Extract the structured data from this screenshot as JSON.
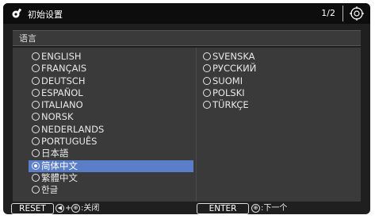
{
  "titlebar": {
    "title": "初始设置",
    "page_indicator": "1/2"
  },
  "section": {
    "label": "语言"
  },
  "languages_left": [
    {
      "label": "ENGLISH",
      "selected": false
    },
    {
      "label": "FRANÇAIS",
      "selected": false
    },
    {
      "label": "DEUTSCH",
      "selected": false
    },
    {
      "label": "ESPAÑOL",
      "selected": false
    },
    {
      "label": "ITALIANO",
      "selected": false
    },
    {
      "label": "NORSK",
      "selected": false
    },
    {
      "label": "NEDERLANDS",
      "selected": false
    },
    {
      "label": "PORTUGUÊS",
      "selected": false
    },
    {
      "label": "日本語",
      "selected": false
    },
    {
      "label": "简体中文",
      "selected": true
    },
    {
      "label": "繁體中文",
      "selected": false
    },
    {
      "label": "한글",
      "selected": false
    }
  ],
  "languages_right": [
    {
      "label": "SVENSKA",
      "selected": false
    },
    {
      "label": "РУССКИЙ",
      "selected": false
    },
    {
      "label": "SUOMI",
      "selected": false
    },
    {
      "label": "POLSKI",
      "selected": false
    },
    {
      "label": "TÜRKÇE",
      "selected": false
    }
  ],
  "footer": {
    "reset_label": "RESET",
    "left_arrow_icon": "◀",
    "plus": "+",
    "enter_icon": "⊕",
    "close_text": ":关闭",
    "enter_label": "ENTER",
    "next_text": ":下一个"
  },
  "colors": {
    "background": "#1f1f1f",
    "panel": "#3a3a3a",
    "selection": "#5a7fc8"
  }
}
